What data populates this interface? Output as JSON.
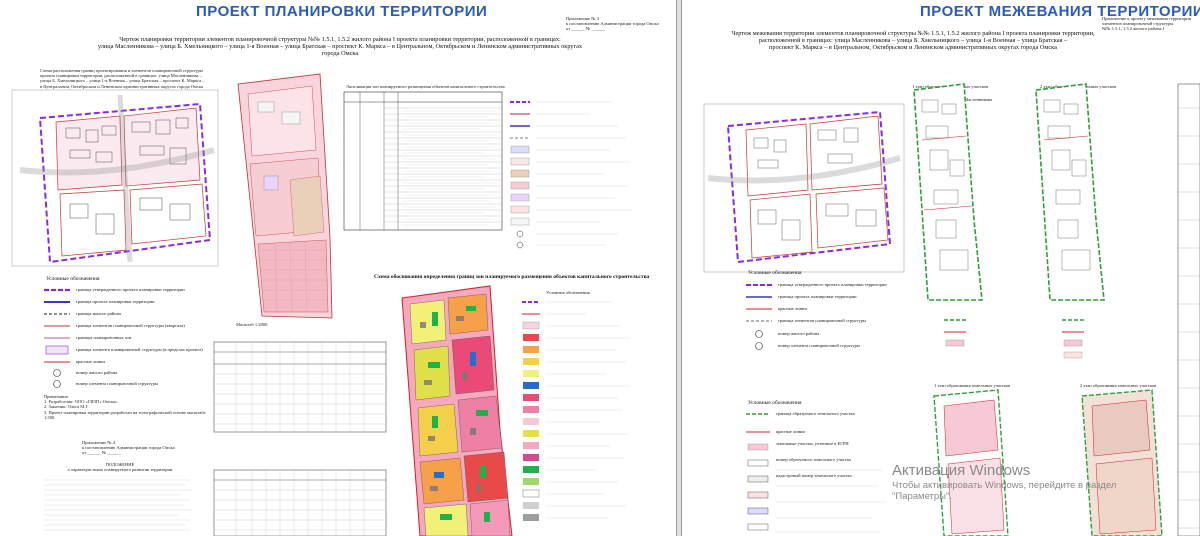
{
  "left_sheet": {
    "title": "ПРОЕКТ ПЛАНИРОВКИ ТЕРРИТОРИИ",
    "appendix": "Приложение № 3\nк постановлению Администрации города Омска\nот ______ № ______",
    "heading": "Чертеж планировки территории элементов планировочной структуры №№ 1.5.1, 1.5.2 жилого района I проекта планировки территории, расположенной в границах:\nулица Масленникова – улица Б. Хмельницкого – улица 1-я Военная – улица Братская – проспект К. Маркса – в Центральном, Октябрьском и Ленинском административных округах города Омска",
    "map_caption": "Схема расположения границ проектирования и элементов планировочной структуры\nпроекта планировки территории, расположенной в границах: улица Масленникова –\nулица Б. Хмельницкого – улица 1-я Военная – улица Братская – проспект К. Маркса –\nв Центральном, Октябрьском и Ленинском административных округах города Омска",
    "table_title": "Экспликация зон планируемого размещения объектов капитального строительства",
    "legend_title": "Условные обозначения",
    "legend_items": [
      "граница утвержденного проекта планировки территории",
      "граница проекта планировки территории",
      "граница жилого района",
      "граница элементов планировочной структуры (квартала)",
      "границы планировочных зон",
      "граница элемента планировочной структуры (в пределах проекта)",
      "красные линии",
      "номер жилого района",
      "номер элемента планировочной структуры"
    ],
    "notes": "Примечание:\n1. Разработчик: ООО «ГИЗП г.Омска».\n2. Заказчик: Ольга М.Т.\n3. Проект планировки территории разработан на топографической основе масштаба 1:500",
    "scale": "Масштаб 1:2000",
    "scheme_title": "Схема обоснования определения границ зон планируемого размещения объектов капитального строительства",
    "scheme_legend_title": "Условные обозначения",
    "appendix_bottom": "Приложение № 4\nк постановлению Администрации города Омска\nот ______ № ______",
    "position_title": "ПОЛОЖЕНИЕ\nо характеристиках планируемого развития территории"
  },
  "right_sheet": {
    "title": "ПРОЕКТ МЕЖЕВАНИЯ ТЕРРИТОРИИ",
    "appendix": "Приложение к проекту межевания территории\nэлементов планировочной структуры\n№№ 1.5.1, 1.5.2 жилого района I",
    "heading": "Чертеж межевания территории элементов планировочной структуры №№ 1.5.1, 1.5.2 жилого района I проекта планировки территории,\nрасположенной в границах: улица Масленникова – улица Б. Хмельницкого – улица 1-я Военная – улица Братская –\nпроспект К. Маркса – в Центральном, Октябрьском и Ленинском административных округах города Омска",
    "scale": "Масштаб 1:2000",
    "stage1": "1 этап образования земельных участков",
    "stage2": "2 этап образования земельных участков",
    "legend_title": "Условные обозначения",
    "legend_items": [
      "граница утвержденного проекта планировки территории",
      "граница проекта планировки территории",
      "красные линии",
      "граница элементов планировочной структуры",
      "номер жилого района",
      "номер элемента планировочной структуры"
    ],
    "legend2_items": [
      "граница образуемого земельного участка",
      "красные линии",
      "земельные участки, учтенные в ЕГРН",
      "номер образуемого земельного участка",
      "кадастровый номер земельного участка"
    ],
    "street_label": "улица Масленникова"
  },
  "watermark": {
    "line1": "Активация Windows",
    "line2": "Чтобы активировать Windows, перейдите в раздел",
    "line3": "\"Параметры\"."
  },
  "colors": {
    "title_blue": "#2a5bbf",
    "purple_boundary": "#8a2be2",
    "red_line": "#d0202a",
    "green_boundary": "#2e9e3a",
    "pink_zone": "#f6c9d4"
  }
}
